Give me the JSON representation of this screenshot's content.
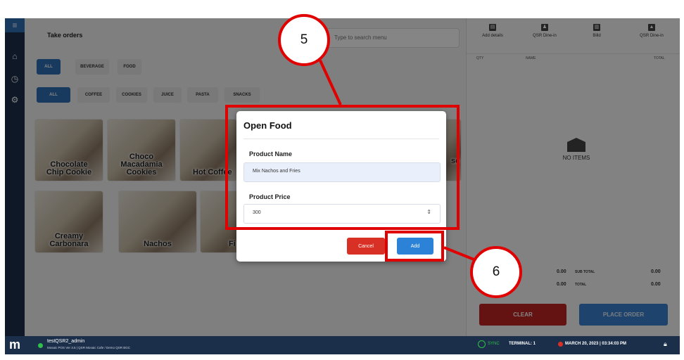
{
  "app": {
    "title": "Take orders",
    "search_placeholder": "Type to search menu"
  },
  "category_tabs": [
    {
      "label": "ALL",
      "active": true
    },
    {
      "label": "BEVERAGE",
      "active": false
    },
    {
      "label": "FOOD",
      "active": false
    }
  ],
  "subcategory_tabs": [
    {
      "label": "ALL",
      "active": true
    },
    {
      "label": "COFFEE",
      "active": false
    },
    {
      "label": "COOKIES",
      "active": false
    },
    {
      "label": "JUICE",
      "active": false
    },
    {
      "label": "PASTA",
      "active": false
    },
    {
      "label": "SNACKS",
      "active": false
    }
  ],
  "menu_items": [
    {
      "name": "Chocolate\nChip Cookie"
    },
    {
      "name": "Choco\nMacadamia\nCookies"
    },
    {
      "name": "Hot Coffee"
    },
    {
      "name": "se"
    },
    {
      "name": "Creamy\nCarbonara"
    },
    {
      "name": "Nachos"
    },
    {
      "name": "Fi"
    }
  ],
  "order_panel": {
    "toolbar": [
      {
        "label": "Add details",
        "icon": "doc-icon"
      },
      {
        "label": "QSR Dine-in",
        "icon": "person-icon"
      },
      {
        "label": "Billd",
        "icon": "bill-icon"
      },
      {
        "label": "QSR Dine-in",
        "icon": "home-icon"
      }
    ],
    "columns": {
      "qty": "QTY",
      "name": "NAME",
      "total": "TOTAL"
    },
    "empty_text": "NO ITEMS",
    "sub_total_label": "SUB TOTAL",
    "total_label": "TOTAL",
    "sub_total_value_left": "0.00",
    "sub_total_value_right": "0.00",
    "total_value_left": "0.00",
    "total_value_right": "0.00",
    "clear_label": "CLEAR",
    "place_order_label": "PLACE ORDER"
  },
  "modal": {
    "title": "Open Food",
    "product_name_label": "Product Name",
    "product_name_value": "Mix Nachos and Fries",
    "product_price_label": "Product Price",
    "product_price_value": "300",
    "cancel_label": "Cancel",
    "add_label": "Add"
  },
  "status_bar": {
    "user": "testQSR2_admin",
    "version": "Mosaic POS Ver 3.5 | QSR Mosaic Cafe / Demo QSR BGC",
    "sync": "SYNC",
    "terminal": "TERMINAL: 1",
    "datetime": "MARCH 20, 2023 | 03:34:03 PM"
  },
  "annotations": {
    "step5": "5",
    "step6": "6"
  },
  "colors": {
    "accent": "#2e6fb7",
    "sidebar": "#1c2f4a",
    "annotation": "#e00000",
    "clear": "#c02424"
  }
}
